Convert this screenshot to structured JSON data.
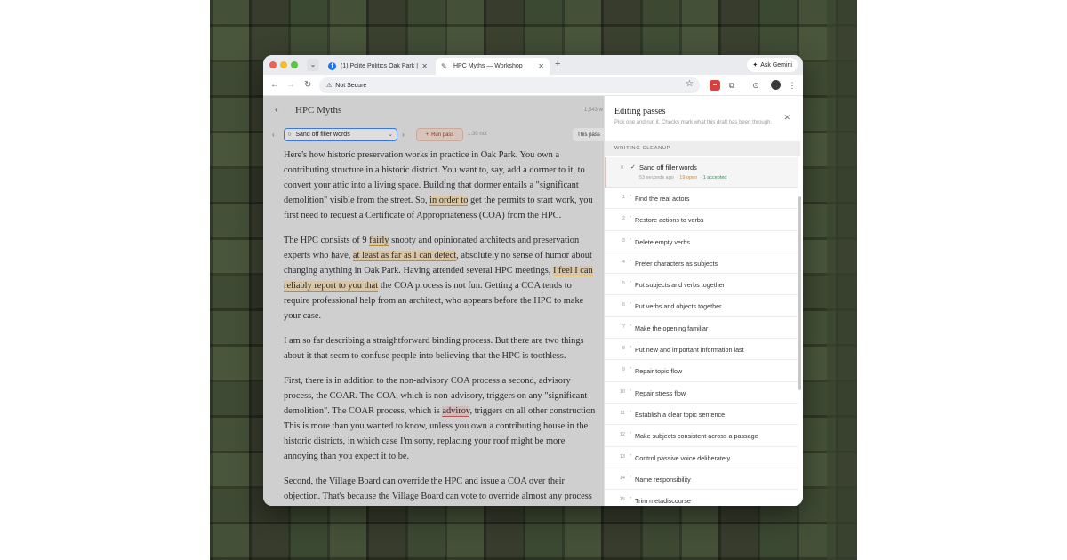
{
  "browser": {
    "tabs": [
      {
        "label": "(1) Polite Politics Oak Park | F",
        "icon": "facebook-icon",
        "active": false
      },
      {
        "label": "HPC Myths — Workshop",
        "icon": "pen-icon",
        "active": true
      }
    ],
    "ask_gemini": "Ask Gemini",
    "security_label": "Not Secure"
  },
  "editor": {
    "title": "HPC Myths",
    "word_count": "1,543 w",
    "pass_select": {
      "number": "0",
      "value": "Sand off filler words"
    },
    "run_button": "Run pass",
    "run_info": "1:30 not",
    "this_pass": "This pass",
    "paragraphs": [
      {
        "segments": [
          {
            "text": "Here's how historic preservation works in practice in Oak Park. You own a",
            "hl": ""
          },
          {
            "text": "\n",
            "hl": ""
          },
          {
            "text": "contributing structure in a historic district. You want to, say, add a dormer to it, to",
            "hl": ""
          },
          {
            "text": "\n",
            "hl": ""
          },
          {
            "text": "convert your attic into a living space. Building that dormer entails a \"significant",
            "hl": ""
          },
          {
            "text": "\n",
            "hl": ""
          },
          {
            "text": "demolition\" visible from the street. So, ",
            "hl": ""
          },
          {
            "text": "in order to",
            "hl": "tan"
          },
          {
            "text": " get the permits to start work, you",
            "hl": ""
          },
          {
            "text": "\n",
            "hl": ""
          },
          {
            "text": "first need to request a Certificate of Appropriateness (COA) from the HPC.",
            "hl": ""
          }
        ]
      },
      {
        "segments": [
          {
            "text": "The HPC consists of 9 ",
            "hl": ""
          },
          {
            "text": "fairly",
            "hl": "tan"
          },
          {
            "text": " snooty and opinionated architects and preservation",
            "hl": ""
          },
          {
            "text": "\n",
            "hl": ""
          },
          {
            "text": "experts who have, ",
            "hl": ""
          },
          {
            "text": "at least as far as I can detect",
            "hl": "tan"
          },
          {
            "text": ", absolutely no sense of humor about",
            "hl": ""
          },
          {
            "text": "\n",
            "hl": ""
          },
          {
            "text": "changing anything in Oak Park. Having attended several HPC meetings, ",
            "hl": ""
          },
          {
            "text": "I feel I can",
            "hl": "tan"
          },
          {
            "text": "\n",
            "hl": ""
          },
          {
            "text": "reliably report to you that",
            "hl": "tan"
          },
          {
            "text": " the COA process is not fun. Getting a COA tends to",
            "hl": ""
          },
          {
            "text": "\n",
            "hl": ""
          },
          {
            "text": "require professional help from an architect, who appears before the HPC to make",
            "hl": ""
          },
          {
            "text": "\n",
            "hl": ""
          },
          {
            "text": "your case.",
            "hl": ""
          }
        ]
      },
      {
        "segments": [
          {
            "text": "I am so far describing a straightforward binding process. But there are two things",
            "hl": ""
          },
          {
            "text": "\n",
            "hl": ""
          },
          {
            "text": "about it that seem to confuse people into believing that the HPC is toothless.",
            "hl": ""
          }
        ]
      },
      {
        "segments": [
          {
            "text": "First, there is in addition to the non-advisory COA process a second, advisory",
            "hl": ""
          },
          {
            "text": "\n",
            "hl": ""
          },
          {
            "text": "process, the COAR. The COA, which is non-advisory, triggers on any \"significant",
            "hl": ""
          },
          {
            "text": "\n",
            "hl": ""
          },
          {
            "text": "demolition\". The COAR process, which is ",
            "hl": ""
          },
          {
            "text": "advirov",
            "hl": "pink"
          },
          {
            "text": ", triggers on all other construction",
            "hl": ""
          },
          {
            "text": "\n",
            "hl": ""
          },
          {
            "text": "This is more than you wanted to know, unless you own a contributing house in the",
            "hl": ""
          },
          {
            "text": "\n",
            "hl": ""
          },
          {
            "text": "historic districts, in which case I'm sorry, replacing your roof might be more",
            "hl": ""
          },
          {
            "text": "\n",
            "hl": ""
          },
          {
            "text": "annoying than you expect it to be.",
            "hl": ""
          }
        ]
      },
      {
        "segments": [
          {
            "text": "Second, the Village Board can override the HPC and issue a COA over their",
            "hl": ""
          },
          {
            "text": "\n",
            "hl": ""
          },
          {
            "text": "objection. That's because the Village Board can vote to override almost any process",
            "hl": ""
          }
        ]
      }
    ]
  },
  "panel": {
    "title": "Editing passes",
    "subtitle": "Pick one and run it. Checks mark what this draft has been through.",
    "section": "WRITING CLEANUP",
    "active_pass": {
      "number": "0",
      "label": "Sand off filler words",
      "time": "53 seconds ago",
      "open": "19 open",
      "accepted": "1 accepted"
    },
    "passes": [
      {
        "number": "1",
        "label": "Find the real actors"
      },
      {
        "number": "2",
        "label": "Restore actions to verbs"
      },
      {
        "number": "3",
        "label": "Delete empty verbs"
      },
      {
        "number": "4",
        "label": "Prefer characters as subjects"
      },
      {
        "number": "5",
        "label": "Put subjects and verbs together"
      },
      {
        "number": "6",
        "label": "Put verbs and objects together"
      },
      {
        "number": "7",
        "label": "Make the opening familiar"
      },
      {
        "number": "8",
        "label": "Put new and important information last"
      },
      {
        "number": "9",
        "label": "Repair topic flow"
      },
      {
        "number": "10",
        "label": "Repair stress flow"
      },
      {
        "number": "11",
        "label": "Establish a clear topic sentence"
      },
      {
        "number": "12",
        "label": "Make subjects consistent across a passage"
      },
      {
        "number": "13",
        "label": "Control passive voice deliberately"
      },
      {
        "number": "14",
        "label": "Name responsibility"
      },
      {
        "number": "15",
        "label": "Trim metadiscourse"
      }
    ]
  }
}
